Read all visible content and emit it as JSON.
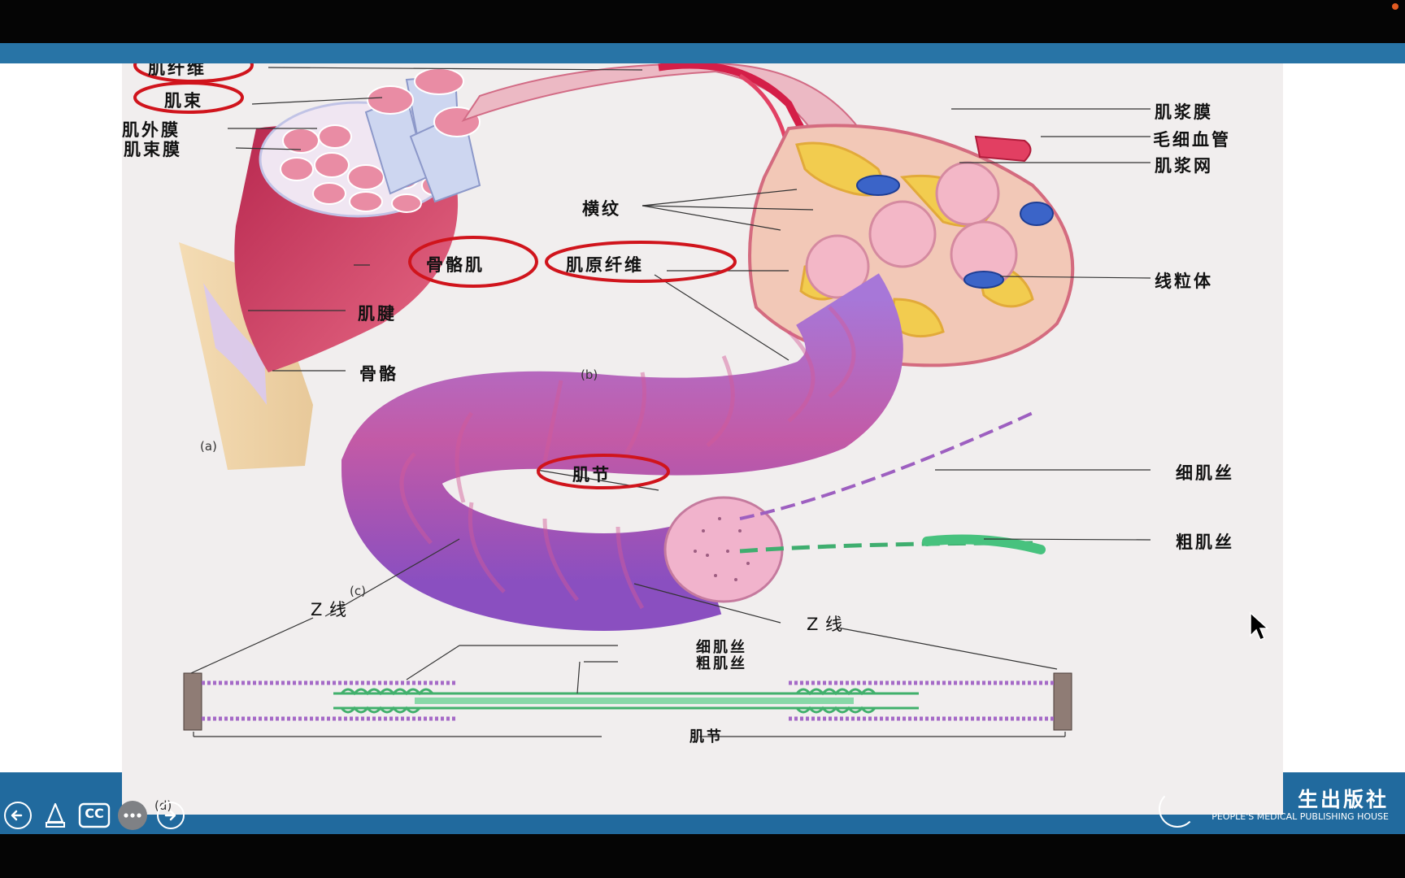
{
  "figure": {
    "labels": {
      "muscle_fiber": "肌纤维",
      "fascicle": "肌束",
      "epimysium": "肌外膜",
      "perimysium": "肌束膜",
      "skeletal_muscle": "骨骼肌",
      "tendon": "肌腱",
      "bone": "骨骼",
      "sarcolemma": "肌浆膜",
      "capillary": "毛细血管",
      "sarcoplasmic_reticulum": "肌浆网",
      "striations": "横纹",
      "myofibril": "肌原纤维",
      "mitochondria": "线粒体",
      "thin_filament": "细肌丝",
      "thick_filament": "粗肌丝",
      "sarcomere": "肌节",
      "z_line_left": "Z 线",
      "z_line_right": "Z 线",
      "thin_filament_bottom": "细肌丝",
      "thick_filament_bottom": "粗肌丝",
      "sarcomere_bottom": "肌节",
      "panel_a": "(a)",
      "panel_b": "(b)",
      "panel_c": "(c)",
      "panel_d": "(d)"
    },
    "colors": {
      "highlight_ellipse": "#d0141c",
      "muscle_red": "#c8345c",
      "myofibril_purple": "#9a52c2",
      "filament_green": "#3cab72"
    }
  },
  "publisher": {
    "name_cn": "生出版社",
    "name_en": "PEOPLE'S MEDICAL PUBLISHING HOUSE"
  },
  "controls": {
    "prev_icon": "arrow-left-circle-icon",
    "pen_icon": "pen-icon",
    "captions_label": "CC",
    "more_icon": "more-icon",
    "next_icon": "arrow-right-circle-icon"
  }
}
